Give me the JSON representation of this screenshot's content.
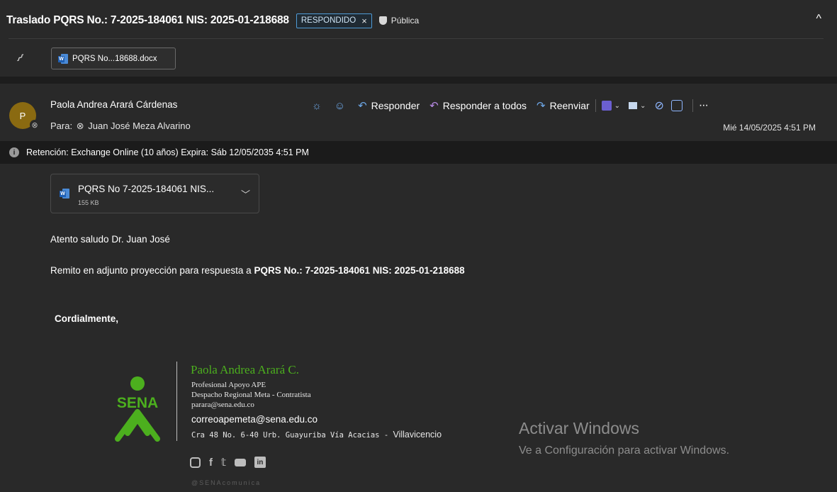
{
  "header": {
    "subject": "Traslado PQRS No.: 7-2025-184061 NIS: 2025-01-218688",
    "status_badge": "RESPONDIDO",
    "badge_close": "×",
    "sensitivity": "Pública",
    "collapse_glyph": "^"
  },
  "attachments_bar": {
    "file_chip": "PQRS No...18688.docx"
  },
  "message": {
    "avatar_initial": "P",
    "sender": "Paola Andrea Arará Cárdenas",
    "to_label": "Para:",
    "recipient": "Juan José Meza Alvarino",
    "date": "Mié 14/05/2025 4:51 PM",
    "actions": {
      "reply": "Responder",
      "reply_all": "Responder a todos",
      "forward": "Reenviar",
      "more": "···"
    }
  },
  "retention": {
    "text": "Retención: Exchange Online (10 años) Expira: Sáb 12/05/2035 4:51 PM"
  },
  "body": {
    "attachment": {
      "name": "PQRS No 7-2025-184061 NIS...",
      "size": "155 KB"
    },
    "greeting": "Atento saludo Dr. Juan José",
    "line2_prefix": "Remito en adjunto proyección para respuesta a",
    "line2_ref": "PQRS No.: 7-2025-184061 NIS: 2025-01-218688",
    "closing": "Cordialmente,"
  },
  "signature": {
    "logo_text": "SENA",
    "name": "Paola Andrea Arará C.",
    "role": "Profesional Apoyo APE",
    "office": "Despacho Regional Meta - Contratista",
    "email1": "parara@sena.edu.co",
    "email2": "correoapemeta@sena.edu.co",
    "address": "Cra 48 No. 6-40 Urb. Guayuriba Vía Acacias -",
    "city": "Villavicencio",
    "handle": "@SENAcomunica",
    "brand_color": "#4caf1e"
  },
  "watermark": {
    "title": "Activar Windows",
    "subtitle": "Ve a Configuración para activar Windows."
  }
}
